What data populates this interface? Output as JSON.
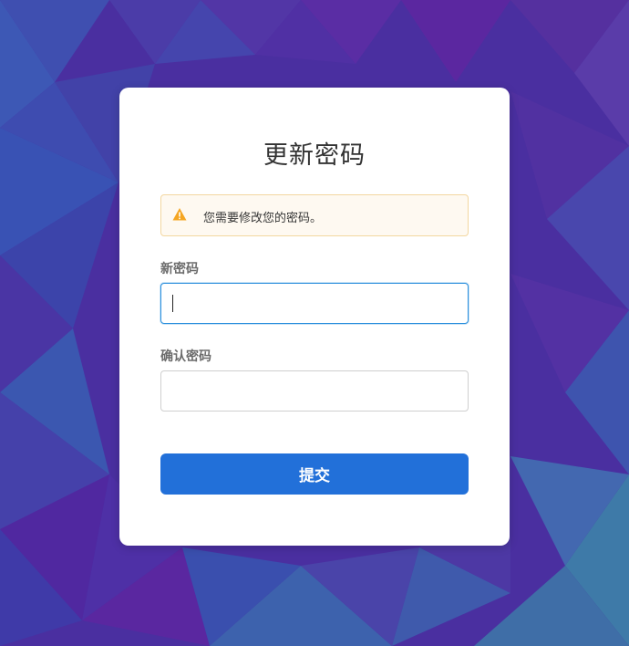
{
  "colors": {
    "accent": "#2270d9",
    "focus_border": "#2a8fdd",
    "warning_icon": "#f5a623",
    "warning_bg": "#fef9f1",
    "warning_border": "#f3d7a0",
    "background_primary": "#4b2fa0"
  },
  "page": {
    "title": "更新密码"
  },
  "alert": {
    "icon": "warning-triangle-icon",
    "text": "您需要修改您的密码。"
  },
  "form": {
    "new_password": {
      "label": "新密码",
      "value": ""
    },
    "confirm_password": {
      "label": "确认密码",
      "value": ""
    },
    "submit_label": "提交"
  }
}
